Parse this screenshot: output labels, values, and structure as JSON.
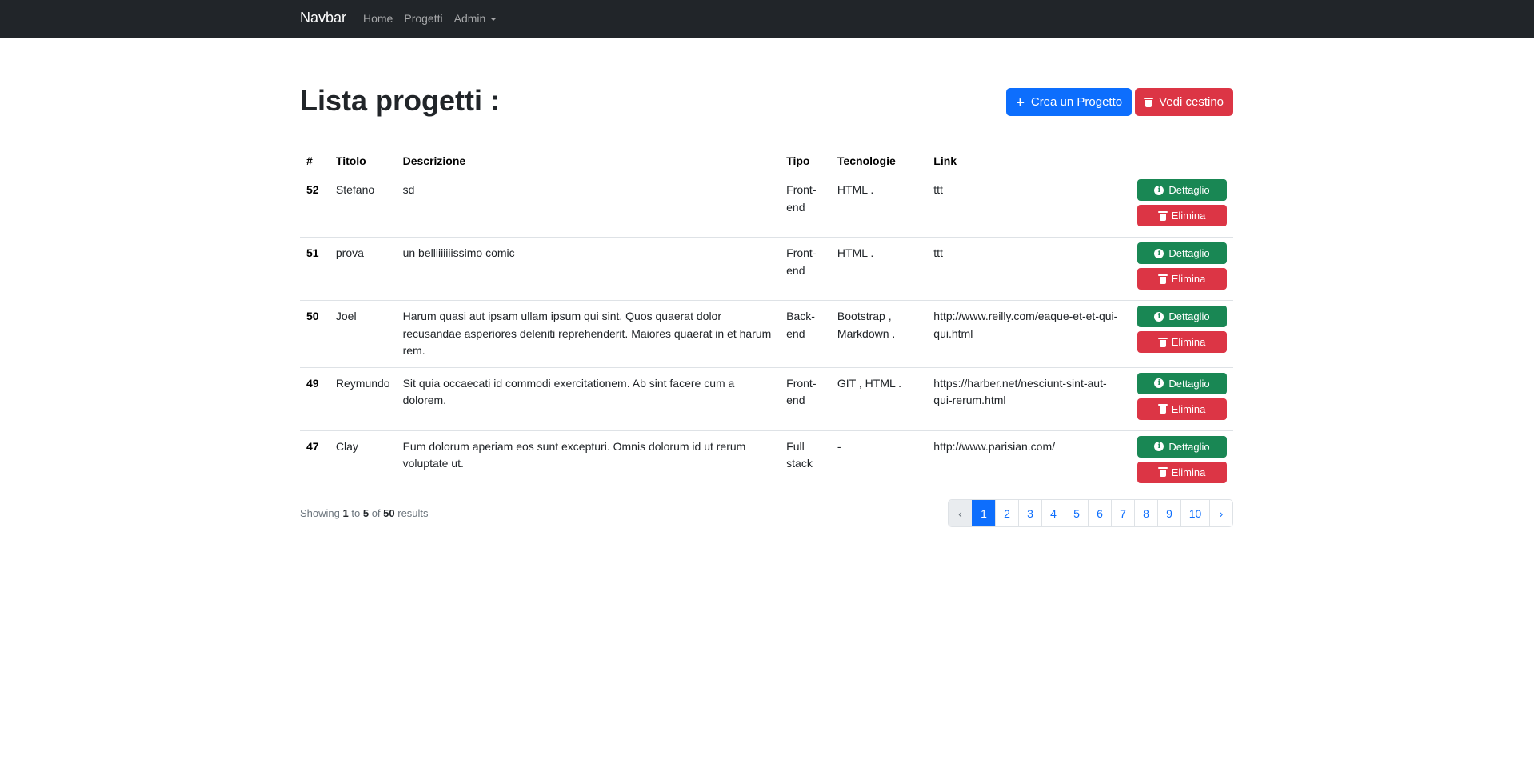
{
  "navbar": {
    "brand": "Navbar",
    "links": [
      {
        "label": "Home"
      },
      {
        "label": "Progetti"
      },
      {
        "label": "Admin"
      }
    ]
  },
  "page": {
    "title": "Lista progetti :",
    "create_button": "Crea un Progetto",
    "trash_button": "Vedi cestino"
  },
  "table": {
    "headers": [
      "#",
      "Titolo",
      "Descrizione",
      "Tipo",
      "Tecnologie",
      "Link"
    ],
    "detail_label": "Dettaglio",
    "delete_label": "Elimina",
    "rows": [
      {
        "id": "52",
        "titolo": "Stefano",
        "descrizione": "sd",
        "tipo": "Front-end",
        "tecnologie": "HTML .",
        "link": "ttt"
      },
      {
        "id": "51",
        "titolo": "prova",
        "descrizione": "un belliiiiiiissimo comic",
        "tipo": "Front-end",
        "tecnologie": "HTML .",
        "link": "ttt"
      },
      {
        "id": "50",
        "titolo": "Joel",
        "descrizione": "Harum quasi aut ipsam ullam ipsum qui sint. Quos quaerat dolor recusandae asperiores deleniti reprehenderit. Maiores quaerat in et harum rem.",
        "tipo": "Back-end",
        "tecnologie": "Bootstrap , Markdown .",
        "link": "http://www.reilly.com/eaque-et-et-qui-qui.html"
      },
      {
        "id": "49",
        "titolo": "Reymundo",
        "descrizione": "Sit quia occaecati id commodi exercitationem. Ab sint facere cum a dolorem.",
        "tipo": "Front-end",
        "tecnologie": "GIT , HTML .",
        "link": "https://harber.net/nesciunt-sint-aut-qui-rerum.html"
      },
      {
        "id": "47",
        "titolo": "Clay",
        "descrizione": "Eum dolorum aperiam eos sunt excepturi. Omnis dolorum id ut rerum voluptate ut.",
        "tipo": "Full stack",
        "tecnologie": "-",
        "link": "http://www.parisian.com/"
      }
    ]
  },
  "footer": {
    "showing": "Showing",
    "from": "1",
    "to_word": "to",
    "to": "5",
    "of_word": "of",
    "total": "50",
    "results_word": "results"
  },
  "pagination": {
    "prev": "‹",
    "next": "›",
    "pages": [
      "1",
      "2",
      "3",
      "4",
      "5",
      "6",
      "7",
      "8",
      "9",
      "10"
    ],
    "active": "1"
  },
  "colors": {
    "navbar_bg": "#212529",
    "primary": "#0d6efd",
    "danger": "#dc3545",
    "success": "#198754"
  },
  "icons": {
    "create": "plus-icon",
    "trash": "trash-icon",
    "detail": "info-circle-icon"
  }
}
